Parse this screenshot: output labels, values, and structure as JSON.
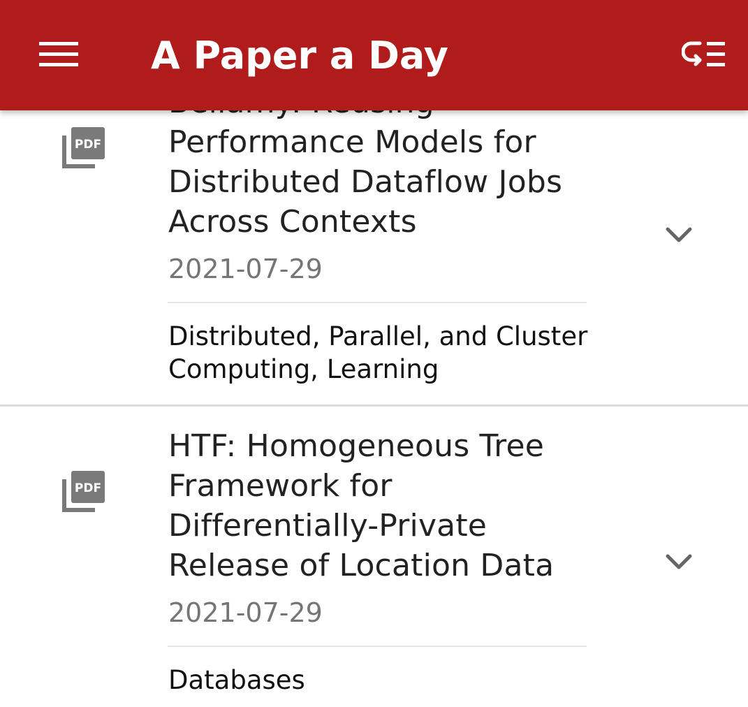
{
  "appbar": {
    "title": "A Paper a Day",
    "background_color": "#b01c1c",
    "menu_icon": "hamburger-menu-icon",
    "filter_icon": "sort-filter-icon"
  },
  "papers": [
    {
      "title_partial": "Bellamy: Reusing",
      "title_lines": [
        "Performance Models for",
        "Distributed Dataflow Jobs",
        "Across Contexts"
      ],
      "date": "2021-07-29",
      "categories_lines": [
        "Distributed, Parallel, and Cluster",
        "Computing, Learning"
      ],
      "pdf_icon": "pdf-icon",
      "expand_icon": "chevron-down-icon"
    },
    {
      "title_lines": [
        "HTF: Homogeneous Tree",
        "Framework for",
        "Differentially-Private",
        "Release of Location Data"
      ],
      "date": "2021-07-29",
      "categories_lines": [
        "Databases"
      ],
      "pdf_icon": "pdf-icon",
      "expand_icon": "chevron-down-icon"
    }
  ]
}
